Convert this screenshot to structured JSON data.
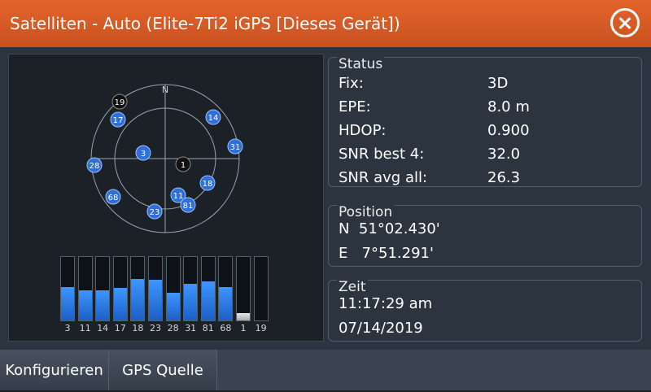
{
  "window": {
    "title": "Satelliten - Auto (Elite-7Ti2 iGPS [Dieses Gerät])"
  },
  "skyview": {
    "north_label": "N",
    "satellites": [
      {
        "prn": "19",
        "color": "dark"
      },
      {
        "prn": "17",
        "color": "blue"
      },
      {
        "prn": "14",
        "color": "blue"
      },
      {
        "prn": "31",
        "color": "blue"
      },
      {
        "prn": "3",
        "color": "blue"
      },
      {
        "prn": "1",
        "color": "dark"
      },
      {
        "prn": "28",
        "color": "blue"
      },
      {
        "prn": "18",
        "color": "blue"
      },
      {
        "prn": "68",
        "color": "blue"
      },
      {
        "prn": "11",
        "color": "blue"
      },
      {
        "prn": "81",
        "color": "blue"
      },
      {
        "prn": "23",
        "color": "blue"
      }
    ]
  },
  "signal_bars": [
    {
      "prn": "3",
      "level": 0.52,
      "color": "blue"
    },
    {
      "prn": "11",
      "level": 0.48,
      "color": "blue"
    },
    {
      "prn": "14",
      "level": 0.48,
      "color": "blue"
    },
    {
      "prn": "17",
      "level": 0.51,
      "color": "blue"
    },
    {
      "prn": "18",
      "level": 0.66,
      "color": "blue"
    },
    {
      "prn": "23",
      "level": 0.64,
      "color": "blue"
    },
    {
      "prn": "28",
      "level": 0.44,
      "color": "blue"
    },
    {
      "prn": "31",
      "level": 0.58,
      "color": "blue"
    },
    {
      "prn": "81",
      "level": 0.61,
      "color": "blue"
    },
    {
      "prn": "68",
      "level": 0.52,
      "color": "blue"
    },
    {
      "prn": "1",
      "level": 0.12,
      "color": "gray"
    },
    {
      "prn": "19",
      "level": 0.0,
      "color": "none"
    }
  ],
  "status": {
    "title": "Status",
    "rows": [
      {
        "label": "Fix:",
        "value": "3D"
      },
      {
        "label": "EPE:",
        "value": "8.0 m"
      },
      {
        "label": "HDOP:",
        "value": "0.900"
      },
      {
        "label": "SNR best 4:",
        "value": "32.0"
      },
      {
        "label": "SNR avg all:",
        "value": "26.3"
      }
    ]
  },
  "position": {
    "title": "Position",
    "lat": "N  51°02.430'",
    "lon": "E   7°51.291'"
  },
  "time": {
    "title": "Zeit",
    "clock": "11:17:29 am",
    "date": "07/14/2019"
  },
  "bottom_tabs": [
    {
      "label": "Konfigurieren"
    },
    {
      "label": "GPS Quelle"
    }
  ],
  "colors": {
    "title_bar": "#d95a24",
    "sat_blue": "#2f6fd6",
    "sat_dark": "#111111",
    "bar_blue": "#2a7ae8"
  }
}
